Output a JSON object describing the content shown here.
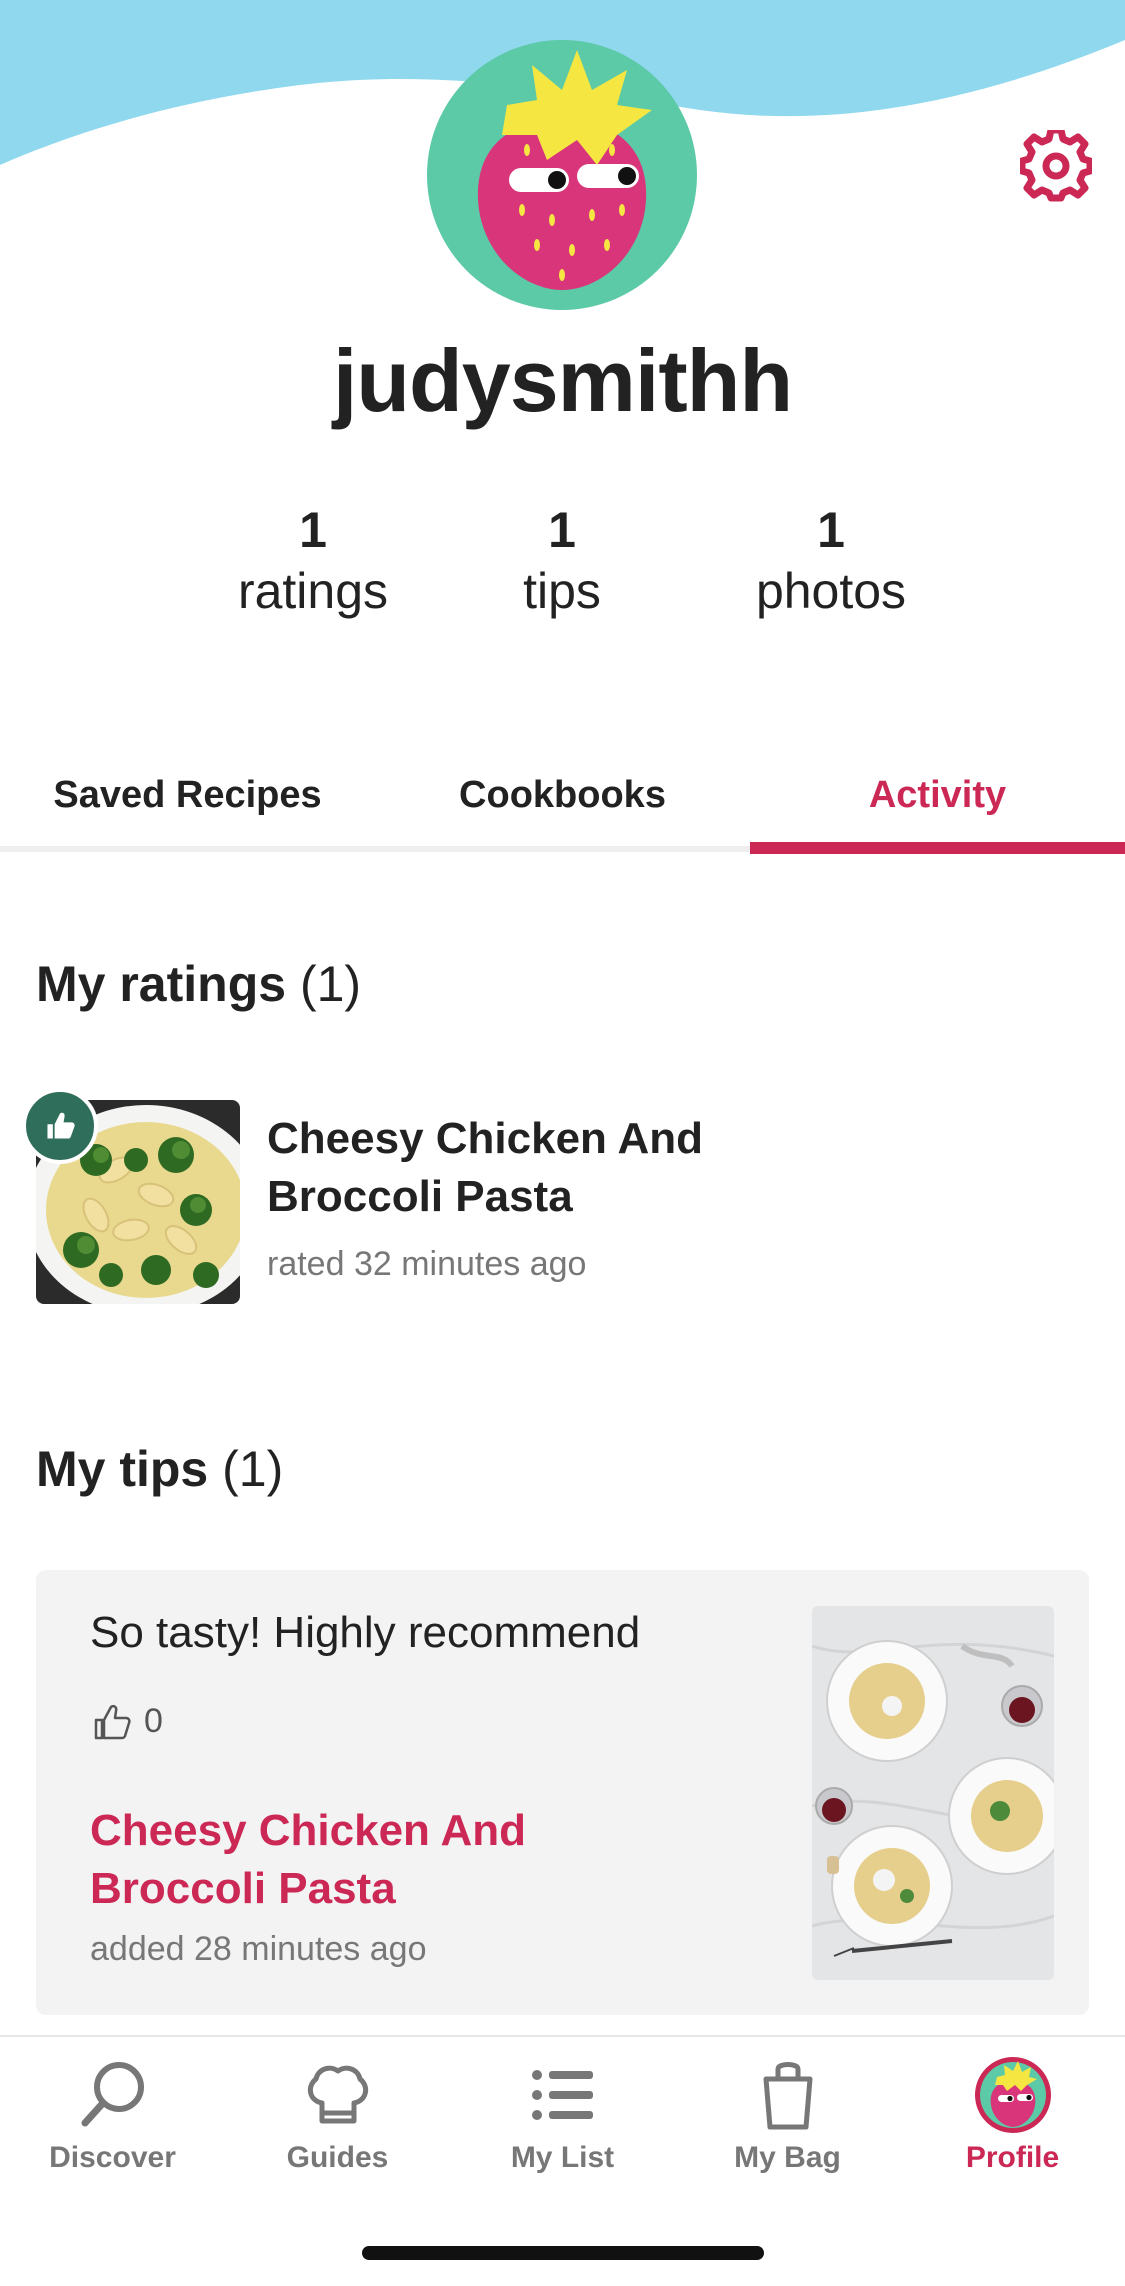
{
  "profile": {
    "username": "judysmithh",
    "stats": [
      {
        "value": "1",
        "label": "ratings"
      },
      {
        "value": "1",
        "label": "tips"
      },
      {
        "value": "1",
        "label": "photos"
      }
    ]
  },
  "tabs": [
    {
      "label": "Saved Recipes",
      "active": false
    },
    {
      "label": "Cookbooks",
      "active": false
    },
    {
      "label": "Activity",
      "active": true
    }
  ],
  "ratings": {
    "title": "My ratings",
    "count": "(1)",
    "item": {
      "title": "Cheesy Chicken And Broccoli Pasta",
      "meta": "rated 32 minutes ago",
      "icon": "thumbs-up-icon"
    }
  },
  "tips": {
    "title": "My tips",
    "count": "(1)",
    "item": {
      "text": "So tasty! Highly recommend",
      "likes": "0",
      "recipe": "Cheesy Chicken And Broccoli Pasta",
      "meta": "added 28 minutes ago"
    }
  },
  "nav": [
    {
      "label": "Discover",
      "icon": "search-icon"
    },
    {
      "label": "Guides",
      "icon": "chef-hat-icon"
    },
    {
      "label": "My List",
      "icon": "list-icon"
    },
    {
      "label": "My Bag",
      "icon": "bag-icon"
    },
    {
      "label": "Profile",
      "icon": "strawberry-avatar-icon",
      "active": true
    }
  ],
  "colors": {
    "accent": "#cc2856",
    "sky": "#8fd8ee",
    "avatar_bg": "#5cc9a7",
    "strawberry": "#d9357a",
    "leaf": "#f5e642",
    "like_badge": "#2f6e5a"
  }
}
